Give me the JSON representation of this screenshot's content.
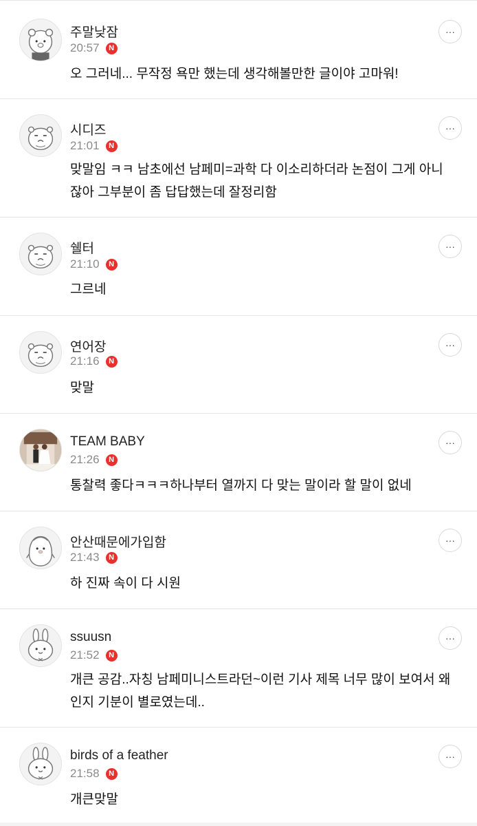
{
  "comments": [
    {
      "author": "주말낮잠",
      "time": "20:57",
      "badge": "N",
      "text": "오 그러네... 무작정 욕만 했는데 생각해볼만한 글이야 고마워!",
      "more_label": "···"
    },
    {
      "author": "시디즈",
      "time": "21:01",
      "badge": "N",
      "text": "맞말임 ㅋㅋ 남초에선 남페미=과학 다 이소리하더라 논점이 그게 아니잖아 그부분이 좀 답답했는데 잘정리함",
      "more_label": "···"
    },
    {
      "author": "쉘터",
      "time": "21:10",
      "badge": "N",
      "text": "그르네",
      "more_label": "···"
    },
    {
      "author": "연어장",
      "time": "21:16",
      "badge": "N",
      "text": "맞말",
      "more_label": "···"
    },
    {
      "author": "TEAM BABY",
      "time": "21:26",
      "badge": "N",
      "text": "통찰력 좋다ㅋㅋㅋ하나부터 열까지 다 맞는 말이라 할 말이 없네",
      "more_label": "···"
    },
    {
      "author": "안산때문에가입함",
      "time": "21:43",
      "badge": "N",
      "text": "하 진짜 속이 다 시원",
      "more_label": "···"
    },
    {
      "author": "ssuusn",
      "time": "21:52",
      "badge": "N",
      "text": "개큰 공감..자칭 남페미니스트라던~이런 기사 제목 너무 많이 보여서 왜인지 기분이 별로였는데..",
      "more_label": "···"
    },
    {
      "author": "birds of a feather",
      "time": "21:58",
      "badge": "N",
      "text": "개큰맞말",
      "more_label": "···"
    }
  ],
  "avatars": [
    "bear-avatar-icon",
    "hamster-avatar-icon",
    "hamster-avatar-icon",
    "hamster-avatar-icon",
    "photo-avatar",
    "penguin-avatar-icon",
    "rabbit-avatar-icon",
    "rabbit-avatar-icon"
  ],
  "colors": {
    "badge": "#e8312d",
    "divider": "#e4e4e4",
    "time": "#8a8a8a"
  }
}
